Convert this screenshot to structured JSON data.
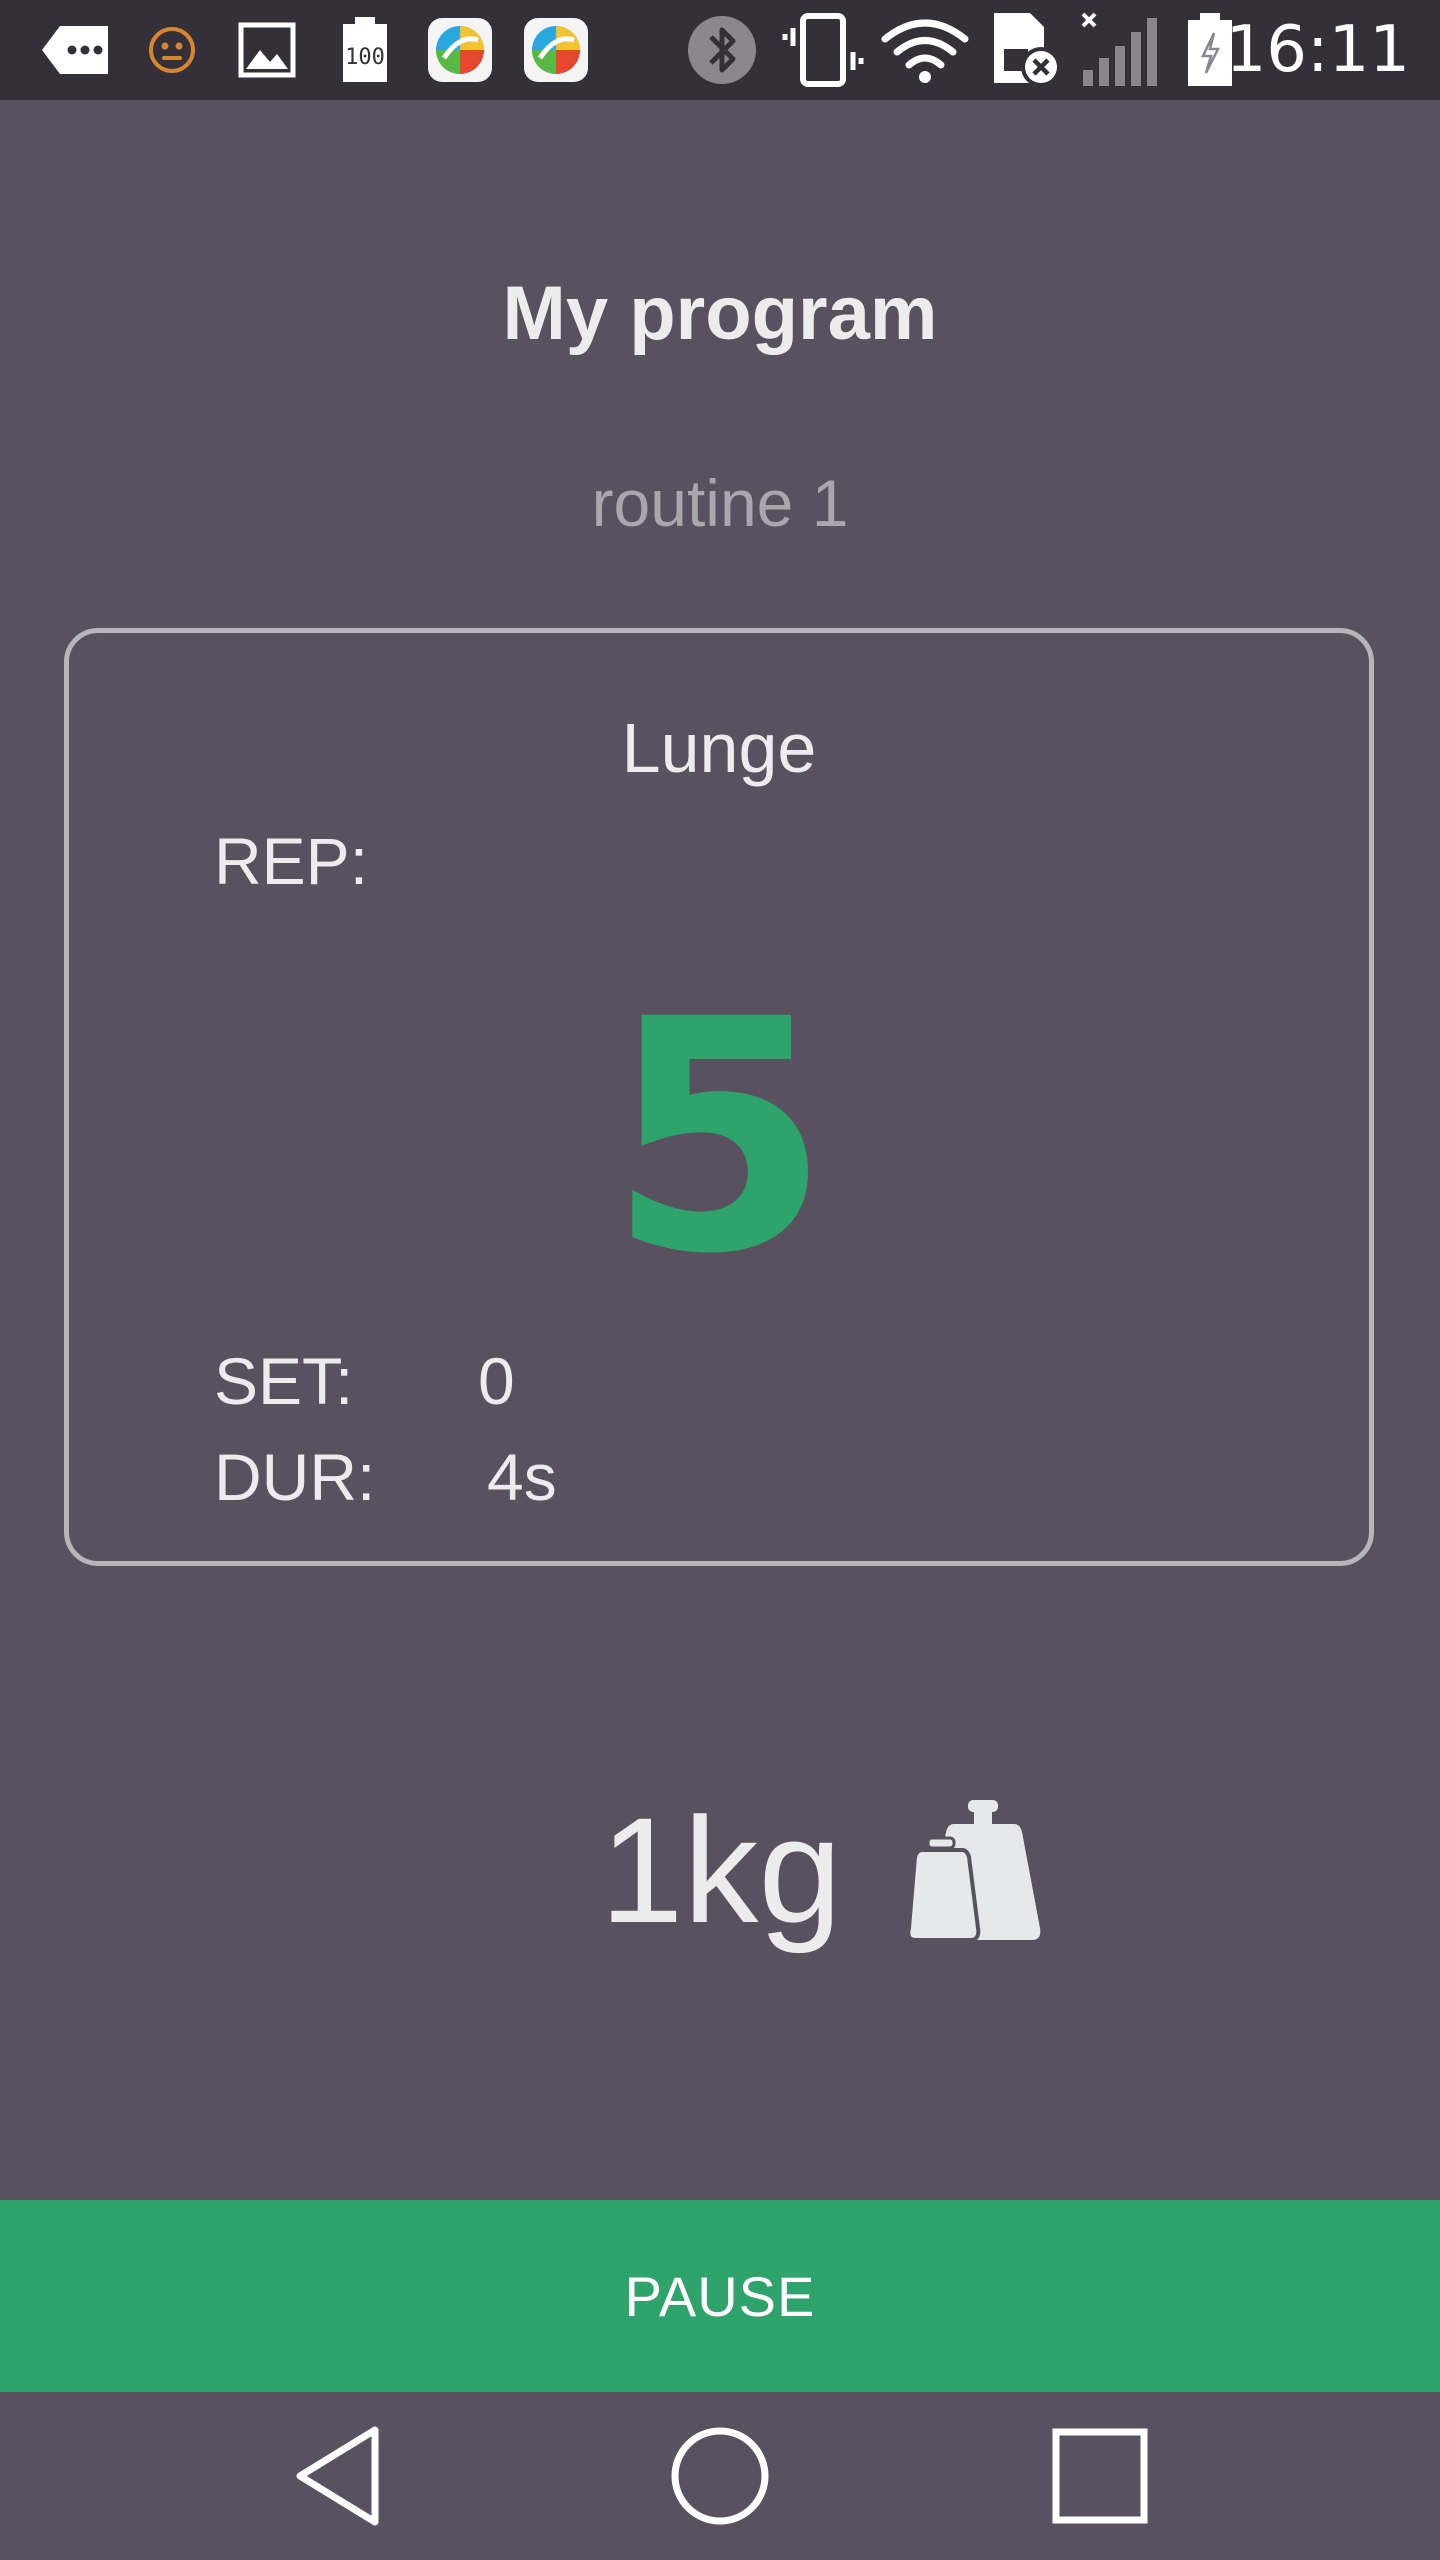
{
  "status_bar": {
    "time": "16:11",
    "icons": [
      "more-dots-icon",
      "face-icon",
      "image-icon",
      "battery-100-icon",
      "app-icon",
      "app-icon",
      "bluetooth-icon",
      "vibrate-icon",
      "wifi-icon",
      "no-sim-icon",
      "signal-icon",
      "battery-charging-icon"
    ],
    "battery_badge": "100"
  },
  "header": {
    "title": "My program",
    "routine": "routine 1"
  },
  "card": {
    "exercise": "Lunge",
    "rep_label": "REP:",
    "rep_count": "5",
    "set_label": "SET:",
    "set_value": "0",
    "dur_label": "DUR:",
    "dur_value": "4s"
  },
  "weight": {
    "value": "1kg",
    "icon": "weights-icon"
  },
  "actions": {
    "pause_label": "PAUSE"
  },
  "nav": {
    "icons": [
      "back-icon",
      "home-icon",
      "recents-icon"
    ]
  },
  "colors": {
    "background": "#595060",
    "status_bar": "#343039",
    "accent": "#2ea36b",
    "text": "#ececec",
    "muted": "#a9a6ac"
  }
}
